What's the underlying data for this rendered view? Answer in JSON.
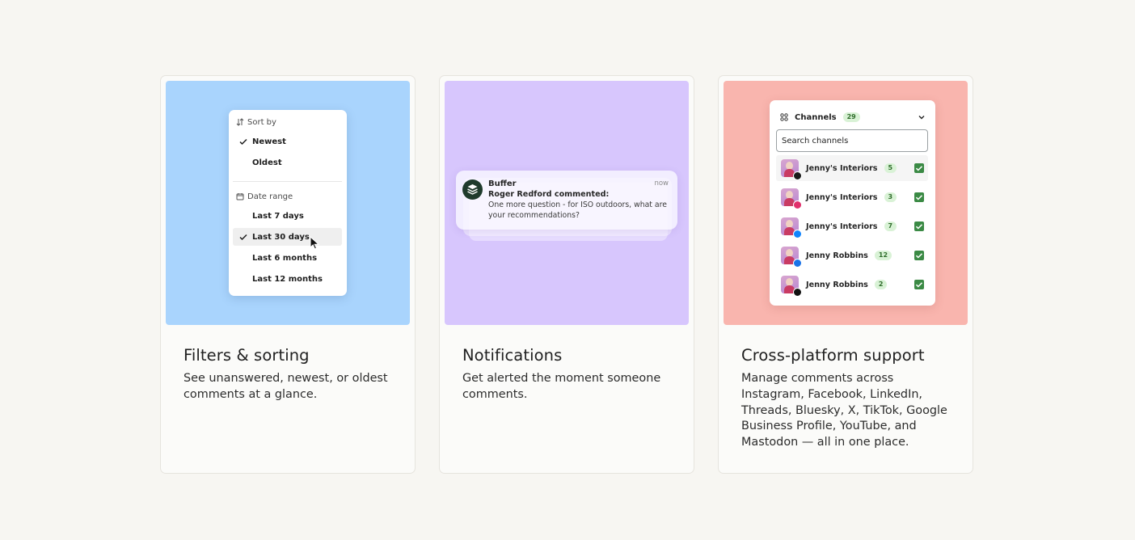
{
  "cards": [
    {
      "title": "Filters & sorting",
      "description": "See unanswered, newest, or oldest comments at a glance.",
      "menu": {
        "sort_header": "Sort by",
        "sort_options": [
          {
            "label": "Newest",
            "checked": true
          },
          {
            "label": "Oldest",
            "checked": false
          }
        ],
        "date_header": "Date range",
        "date_options": [
          {
            "label": "Last 7 days",
            "checked": false
          },
          {
            "label": "Last 30 days",
            "checked": true
          },
          {
            "label": "Last 6 months",
            "checked": false
          },
          {
            "label": "Last 12 months",
            "checked": false
          }
        ]
      }
    },
    {
      "title": "Notifications",
      "description": "Get alerted the moment someone comments.",
      "notification": {
        "app": "Buffer",
        "time": "now",
        "author": "Roger Redford commented:",
        "body": "One more question - for ISO outdoors, what are your recommendations?"
      }
    },
    {
      "title": "Cross-platform support",
      "description": "Manage comments across Instagram, Facebook, LinkedIn, Threads, Bluesky, X, TikTok, Google Business Profile, YouTube, and Mastodon — all in one place.",
      "channels": {
        "label": "Channels",
        "count": "29",
        "search_value": "Search channels",
        "rows": [
          {
            "name": "Jenny's Interiors",
            "count": "5",
            "platform": "threads-icon",
            "badge_color": "#1a1a1a"
          },
          {
            "name": "Jenny's Interiors",
            "count": "3",
            "platform": "instagram-icon",
            "badge_color": "#e1306c"
          },
          {
            "name": "Jenny's Interiors",
            "count": "7",
            "platform": "bluesky-icon",
            "badge_color": "#1185fe"
          },
          {
            "name": "Jenny Robbins",
            "count": "12",
            "platform": "google-business-icon",
            "badge_color": "#1a73e8"
          },
          {
            "name": "Jenny Robbins",
            "count": "2",
            "platform": "x-icon",
            "badge_color": "#111111"
          }
        ]
      }
    }
  ],
  "colors": {
    "page_bg": "#f7f6f2",
    "card1_bg": "#a9d4fd",
    "card2_bg": "#d7c6fd",
    "card3_bg": "#f9b5ae",
    "check_green": "#3b8a45",
    "buffer_logo": "#1f3b2c"
  }
}
